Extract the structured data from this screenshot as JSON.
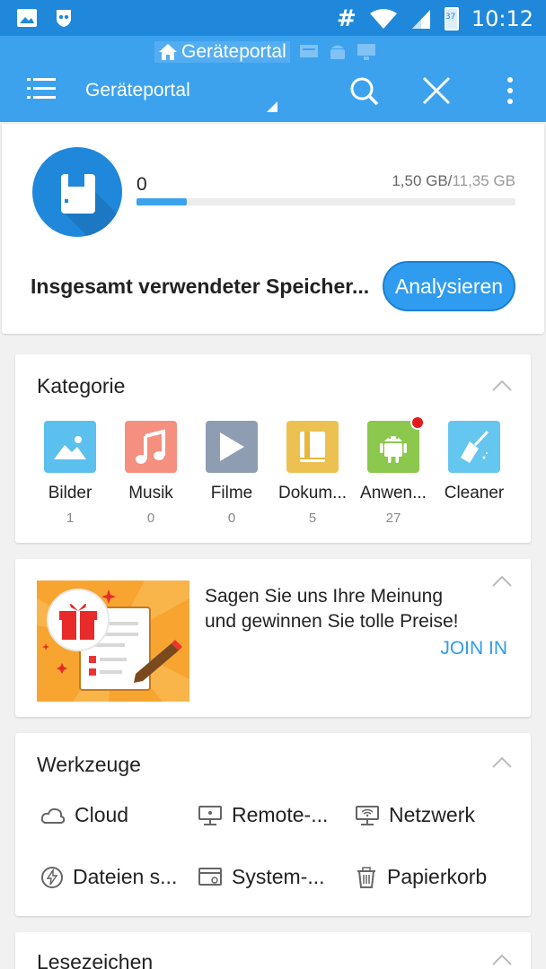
{
  "status_bar": {
    "time": "10:12",
    "network_label": "#",
    "battery_level": "37"
  },
  "crumb": {
    "label": "Geräteportal"
  },
  "app_bar": {
    "title": "Geräteportal"
  },
  "storage": {
    "used_value": "0",
    "size_used": "1,50 GB/",
    "size_total": "11,35 GB",
    "used_fraction": 0.132,
    "label": "Insgesamt verwendeter Speicher...",
    "analyze_label": "Analysieren"
  },
  "categories": {
    "title": "Kategorie",
    "items": [
      {
        "label": "Bilder",
        "count": "1",
        "color": "#5bc0ed",
        "icon": "image-icon"
      },
      {
        "label": "Musik",
        "count": "0",
        "color": "#f58f7f",
        "icon": "music-icon"
      },
      {
        "label": "Filme",
        "count": "0",
        "color": "#8e9db2",
        "icon": "play-icon"
      },
      {
        "label": "Dokum...",
        "count": "5",
        "color": "#ecc152",
        "icon": "document-icon"
      },
      {
        "label": "Anwen...",
        "count": "27",
        "color": "#8cc74e",
        "icon": "android-icon"
      },
      {
        "label": "Cleaner",
        "count": "",
        "color": "#65c6ef",
        "icon": "broom-icon"
      }
    ]
  },
  "promo": {
    "line1": "Sagen Sie uns Ihre Meinung",
    "line2": "und gewinnen Sie tolle Preise!",
    "join_label": "JOIN IN"
  },
  "tools": {
    "title": "Werkzeuge",
    "items": [
      {
        "label": "Cloud",
        "icon": "cloud-icon"
      },
      {
        "label": "Remote-...",
        "icon": "remote-icon"
      },
      {
        "label": "Netzwerk",
        "icon": "network-icon"
      },
      {
        "label": "Dateien s...",
        "icon": "file-share-icon"
      },
      {
        "label": "System-...",
        "icon": "system-icon"
      },
      {
        "label": "Papierkorb",
        "icon": "trash-icon"
      }
    ]
  },
  "bookmarks": {
    "title": "Lesezeichen"
  }
}
